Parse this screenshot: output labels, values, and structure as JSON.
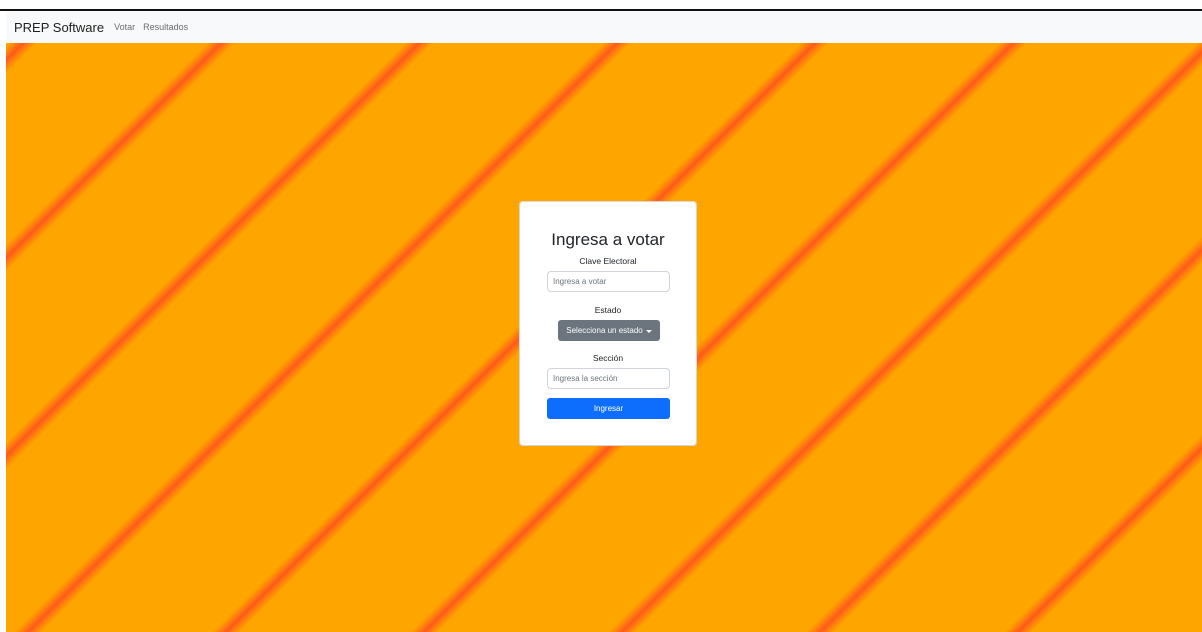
{
  "navbar": {
    "brand": "PREP Software",
    "links": [
      "Votar",
      "Resultados"
    ]
  },
  "form": {
    "title": "Ingresa a votar",
    "clave_label": "Clave Electoral",
    "clave_placeholder": "Ingresa a votar",
    "estado_label": "Estado",
    "estado_button": "Selecciona un estado",
    "seccion_label": "Sección",
    "seccion_placeholder": "Ingresa la sección",
    "submit_label": "Ingresar"
  },
  "colors": {
    "background_primary": "#ffa500",
    "background_stripe": "#ff5a1a",
    "dropdown": "#6c757d",
    "submit": "#0d6efd"
  },
  "icons": {
    "dropdown_caret": "caret-down-icon"
  }
}
